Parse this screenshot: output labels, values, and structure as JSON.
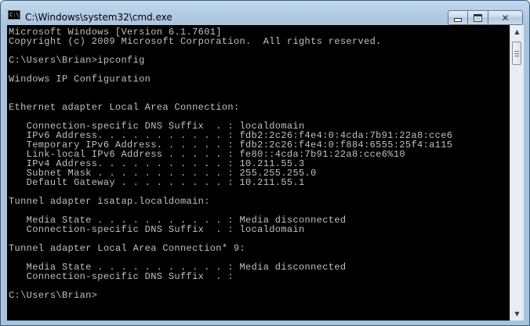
{
  "window": {
    "title": "C:\\Windows\\system32\\cmd.exe",
    "icon": "cmd-prompt-icon",
    "caption_buttons": {
      "minimize": "minimize-icon",
      "maximize": "maximize-icon",
      "close": "close-icon",
      "close_glyph": "✕"
    }
  },
  "console": {
    "background_color": "#000000",
    "text_color": "#c0c0c0",
    "lines": [
      "Microsoft Windows [Version 6.1.7601]",
      "Copyright (c) 2009 Microsoft Corporation.  All rights reserved.",
      "",
      "C:\\Users\\Brian>ipconfig",
      "",
      "Windows IP Configuration",
      "",
      "",
      "Ethernet adapter Local Area Connection:",
      "",
      "   Connection-specific DNS Suffix  . : localdomain",
      "   IPv6 Address. . . . . . . . . . . : fdb2:2c26:f4e4:0:4cda:7b91:22a8:cce6",
      "   Temporary IPv6 Address. . . . . . : fdb2:2c26:f4e4:0:f884:6555:25f4:a115",
      "   Link-local IPv6 Address . . . . . : fe80::4cda:7b91:22a8:cce6%10",
      "   IPv4 Address. . . . . . . . . . . : 10.211.55.3",
      "   Subnet Mask . . . . . . . . . . . : 255.255.255.0",
      "   Default Gateway . . . . . . . . . : 10.211.55.1",
      "",
      "Tunnel adapter isatap.localdomain:",
      "",
      "   Media State . . . . . . . . . . . : Media disconnected",
      "   Connection-specific DNS Suffix  . : localdomain",
      "",
      "Tunnel adapter Local Area Connection* 9:",
      "",
      "   Media State . . . . . . . . . . . : Media disconnected",
      "   Connection-specific DNS Suffix  . :",
      "",
      "C:\\Users\\Brian>"
    ]
  },
  "scrollbar": {
    "up_arrow": "▲",
    "down_arrow": "▼",
    "position_fraction": 0.0
  }
}
